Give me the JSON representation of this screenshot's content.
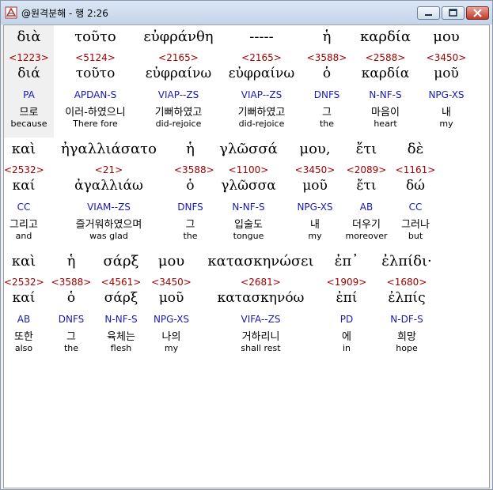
{
  "window": {
    "title": "@원격분해 - 행 2:26",
    "icon": "app-logo-icon"
  },
  "rows": [
    {
      "words": [
        {
          "greek": "διὰ",
          "strong": "<1223>",
          "lemma": "διά",
          "morph": "PA",
          "kor": "므로",
          "eng": "because"
        },
        {
          "greek": "τοῦτο",
          "strong": "<5124>",
          "lemma": "τοῦτο",
          "morph": "APDAN-S",
          "kor": "이러-하였으니",
          "eng": "There fore"
        },
        {
          "greek": "εὐφράνθη",
          "strong": "<2165>",
          "lemma": "εὐφραίνω",
          "morph": "VIAP--ZS",
          "kor": "기뻐하였고",
          "eng": "did-rejoice"
        },
        {
          "greek": "-----",
          "strong": "<2165>",
          "lemma": "εὐφραίνω",
          "morph": "VIAP--ZS",
          "kor": "기뻐하였고",
          "eng": "did-rejoice"
        },
        {
          "greek": "ἡ",
          "strong": "<3588>",
          "lemma": "ὁ",
          "morph": "DNFS",
          "kor": "그",
          "eng": "the"
        },
        {
          "greek": "καρδία",
          "strong": "<2588>",
          "lemma": "καρδία",
          "morph": "N-NF-S",
          "kor": "마음이",
          "eng": "heart"
        },
        {
          "greek": "μου",
          "strong": "<3450>",
          "lemma": "μοῦ",
          "morph": "NPG-XS",
          "kor": "내",
          "eng": "my"
        }
      ]
    },
    {
      "words": [
        {
          "greek": "καὶ",
          "strong": "<2532>",
          "lemma": "καί",
          "morph": "CC",
          "kor": "그리고",
          "eng": "and"
        },
        {
          "greek": "ἠγαλλιάσατο",
          "strong": "<21>",
          "lemma": "ἀγαλλιάω",
          "morph": "VIAM--ZS",
          "kor": "즐거워하였으며",
          "eng": "was glad"
        },
        {
          "greek": "ἡ",
          "strong": "<3588>",
          "lemma": "ὁ",
          "morph": "DNFS",
          "kor": "그",
          "eng": "the"
        },
        {
          "greek": "γλῶσσά",
          "strong": "<1100>",
          "lemma": "γλῶσσα",
          "morph": "N-NF-S",
          "kor": "입술도",
          "eng": "tongue"
        },
        {
          "greek": "μου,",
          "strong": "<3450>",
          "lemma": "μοῦ",
          "morph": "NPG-XS",
          "kor": "내",
          "eng": "my"
        },
        {
          "greek": "ἔτι",
          "strong": "<2089>",
          "lemma": "ἔτι",
          "morph": "AB",
          "kor": "더우기",
          "eng": "moreover"
        },
        {
          "greek": "δὲ",
          "strong": "<1161>",
          "lemma": "δώ",
          "morph": "CC",
          "kor": "그러나",
          "eng": "but"
        }
      ]
    },
    {
      "words": [
        {
          "greek": "καὶ",
          "strong": "<2532>",
          "lemma": "καί",
          "morph": "AB",
          "kor": "또한",
          "eng": "also"
        },
        {
          "greek": "ἡ",
          "strong": "<3588>",
          "lemma": "ὁ",
          "morph": "DNFS",
          "kor": "그",
          "eng": "the"
        },
        {
          "greek": "σάρξ",
          "strong": "<4561>",
          "lemma": "σάρξ",
          "morph": "N-NF-S",
          "kor": "육체는",
          "eng": "flesh"
        },
        {
          "greek": "μου",
          "strong": "<3450>",
          "lemma": "μοῦ",
          "morph": "NPG-XS",
          "kor": "나의",
          "eng": "my"
        },
        {
          "greek": "κατασκηνώσει",
          "strong": "<2681>",
          "lemma": "κατασκηνόω",
          "morph": "VIFA--ZS",
          "kor": "거하리니",
          "eng": "shall rest"
        },
        {
          "greek": "ἐπ᾽",
          "strong": "<1909>",
          "lemma": "ἐπί",
          "morph": "PD",
          "kor": "에",
          "eng": "in"
        },
        {
          "greek": "ἐλπίδι·",
          "strong": "<1680>",
          "lemma": "ἐλπίς",
          "morph": "N-DF-S",
          "kor": "희망",
          "eng": "hope"
        }
      ]
    }
  ]
}
